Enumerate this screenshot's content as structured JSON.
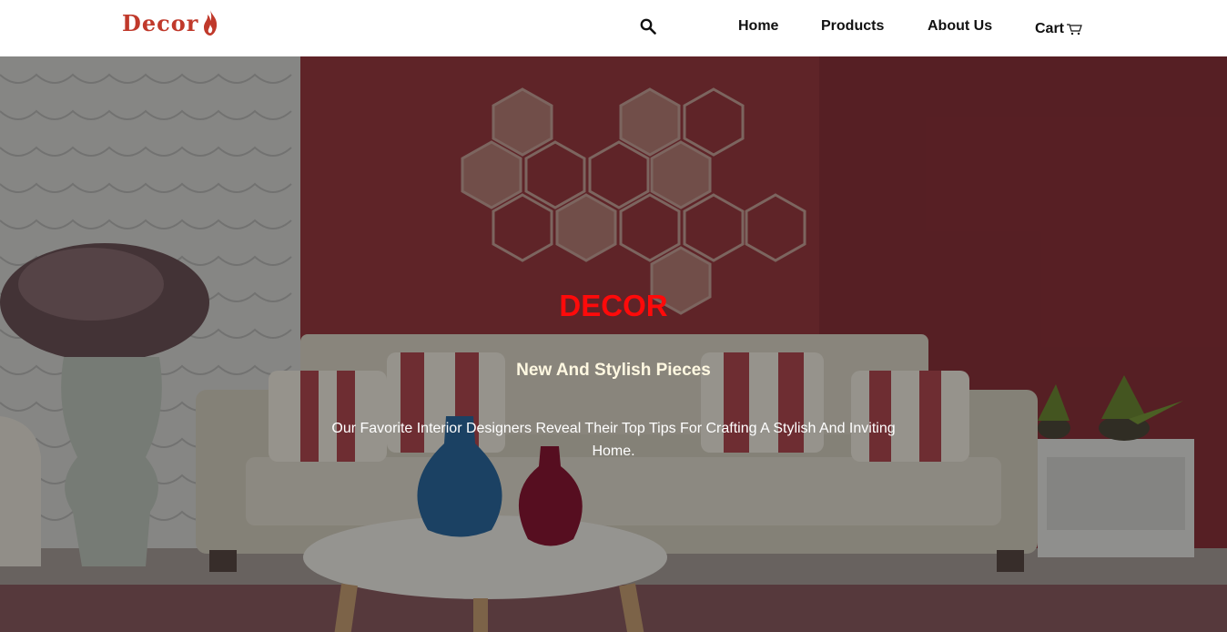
{
  "brand": {
    "name": "Decor",
    "color": "#c0392b"
  },
  "nav": {
    "search_icon": "search-icon",
    "home": "Home",
    "products": "Products",
    "about": "About Us",
    "cart": "Cart",
    "cart_icon": "cart-icon"
  },
  "hero": {
    "title": "DECOR",
    "subtitle": "New And Stylish Pieces",
    "description": "Our Favorite Interior Designers Reveal Their Top Tips For Crafting A Stylish And Inviting Home.",
    "title_color": "#ff0a0a",
    "background_image": "living room with red wall, hexagon wall decor, beige sofa and vases"
  }
}
